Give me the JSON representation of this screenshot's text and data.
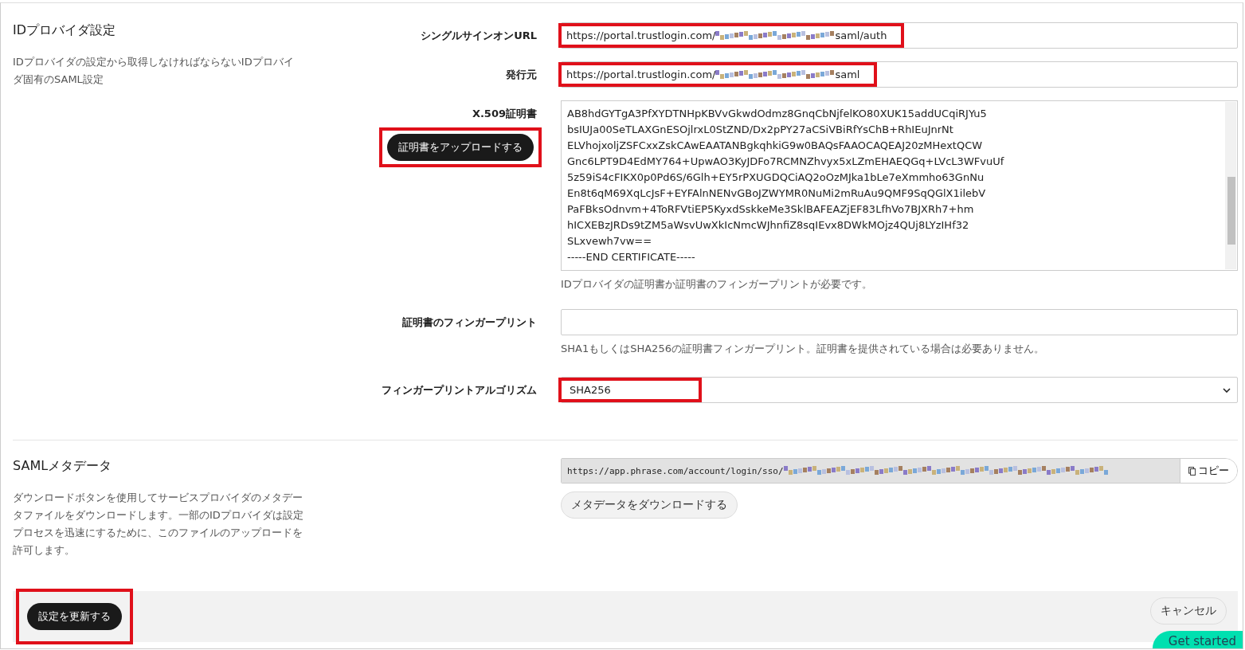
{
  "idp_section": {
    "title": "IDプロバイダ設定",
    "description": "IDプロバイダの設定から取得しなければならないIDプロバイダ固有のSAML設定",
    "fields": [
      {
        "kind": "url",
        "label": "シングルサインオンURL",
        "value_prefix": "https://portal.trustlogin.com/",
        "value_suffix": "saml/auth",
        "highlighted": true
      },
      {
        "kind": "url",
        "label": "発行元",
        "value_prefix": "https://portal.trustlogin.com/",
        "value_suffix": "saml",
        "highlighted": true
      },
      {
        "kind": "certificate",
        "label": "X.509証明書",
        "upload_button": "証明書をアップロードする",
        "highlighted": true,
        "lines": [
          "AB8hdGYTgA3PfXYDTNHpKBVvGkwdOdmz8GnqCbNjfelKO80XUK15addUCqiRJYu5",
          "bsIUJa00SeTLAXGnESOjlrxL0StZND/Dx2pPY27aCSiVBiRfYsChB+RhIEuJnrNt",
          "ELVhojxoljZSFCxxZskCAwEAATANBgkqhkiG9w0BAQsFAAOCAQEAJ20zMHextQCW",
          "Gnc6LPT9D4EdMY764+UpwAO3KyJDFo7RCMNZhvyx5xLZmEHAEQGq+LVcL3WFvuUf",
          "5z59iS4cFIKX0p0Pd6S/6Glh+EY5rPXUGDQCiAQ2oOzMJka1bLe7eXmmho63GnNu",
          "En8t6qM69XqLcJsF+EYFAlnNENvGBoJZWYMR0NuMi2mRuAu9QMF9SqQGlX1ilebV",
          "PaFBksOdnvm+4ToRFVtiEP5KyxdSskkeMe3SklBAFEAZjEF83LfhVo7BJXRh7+hm",
          "hICXEBzJRDs9tZM5aWsvUwXkIcNmcWJhnfiZ8sqIEvx8DWkMOjz4QUj8LYzIHf32",
          "SLxvewh7vw==",
          "-----END CERTIFICATE-----"
        ],
        "hint": "IDプロバイダの証明書か証明書のフィンガープリントが必要です。"
      },
      {
        "kind": "text",
        "label": "証明書のフィンガープリント",
        "hint": "SHA1もしくはSHA256の証明書フィンガープリント。証明書を提供されている場合は必要ありません。"
      },
      {
        "kind": "select",
        "label": "フィンガープリントアルゴリズム",
        "value": "SHA256",
        "highlighted": true
      }
    ]
  },
  "metadata_section": {
    "title": "SAMLメタデータ",
    "description": "ダウンロードボタンを使用してサービスプロバイダのメタデータファイルをダウンロードします。一部のIDプロバイダは設定プロセスを迅速にするために、このファイルのアップロードを許可します。",
    "url_prefix": "https://app.phrase.com/account/login/sso/",
    "copy_button": "コピー",
    "download_button": "メタデータをダウンロードする"
  },
  "footer": {
    "update_button": "設定を更新する",
    "update_highlighted": true,
    "cancel_button": "キャンセル"
  },
  "help_button": "Get started"
}
